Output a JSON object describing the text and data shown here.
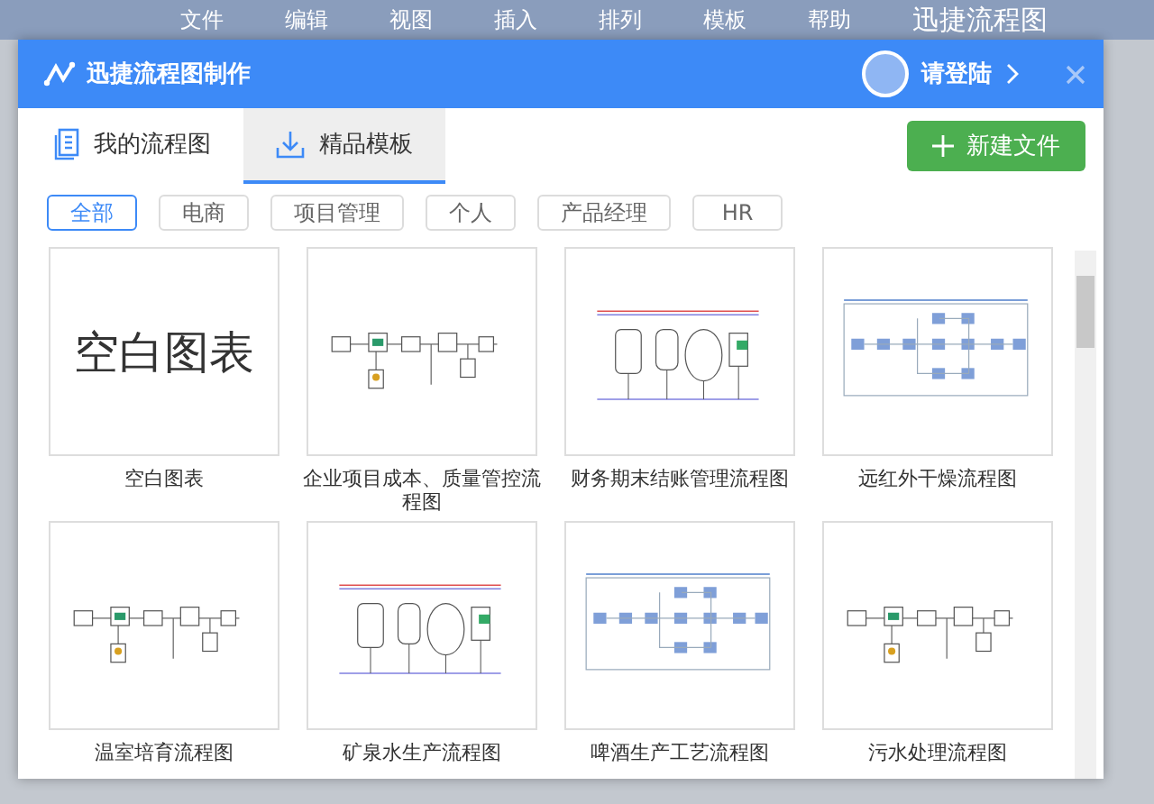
{
  "backdrop": {
    "menu": [
      "文件",
      "编辑",
      "视图",
      "插入",
      "排列",
      "模板",
      "帮助"
    ],
    "app_title": "迅捷流程图"
  },
  "dialog": {
    "title": "迅捷流程图制作",
    "login": "请登陆"
  },
  "tabs": [
    {
      "label": "我的流程图",
      "selected": false
    },
    {
      "label": "精品模板",
      "selected": true
    }
  ],
  "new_file_button": {
    "label": "新建文件"
  },
  "filters": [
    {
      "label": "全部",
      "selected": true
    },
    {
      "label": "电商",
      "selected": false
    },
    {
      "label": "项目管理",
      "selected": false
    },
    {
      "label": "个人",
      "selected": false
    },
    {
      "label": "产品经理",
      "selected": false
    },
    {
      "label": "HR",
      "selected": false
    }
  ],
  "templates": [
    {
      "kind": "blank",
      "preview_text": "空白图表",
      "label": "空白图表"
    },
    {
      "kind": "diagram",
      "label": "企业项目成本、质量管控流程图"
    },
    {
      "kind": "diagram",
      "label": "财务期末结账管理流程图"
    },
    {
      "kind": "diagram",
      "label": "远红外干燥流程图"
    },
    {
      "kind": "diagram",
      "label": "温室培育流程图"
    },
    {
      "kind": "diagram",
      "label": "矿泉水生产流程图"
    },
    {
      "kind": "diagram",
      "label": "啤酒生产工艺流程图"
    },
    {
      "kind": "diagram",
      "label": "污水处理流程图"
    }
  ]
}
